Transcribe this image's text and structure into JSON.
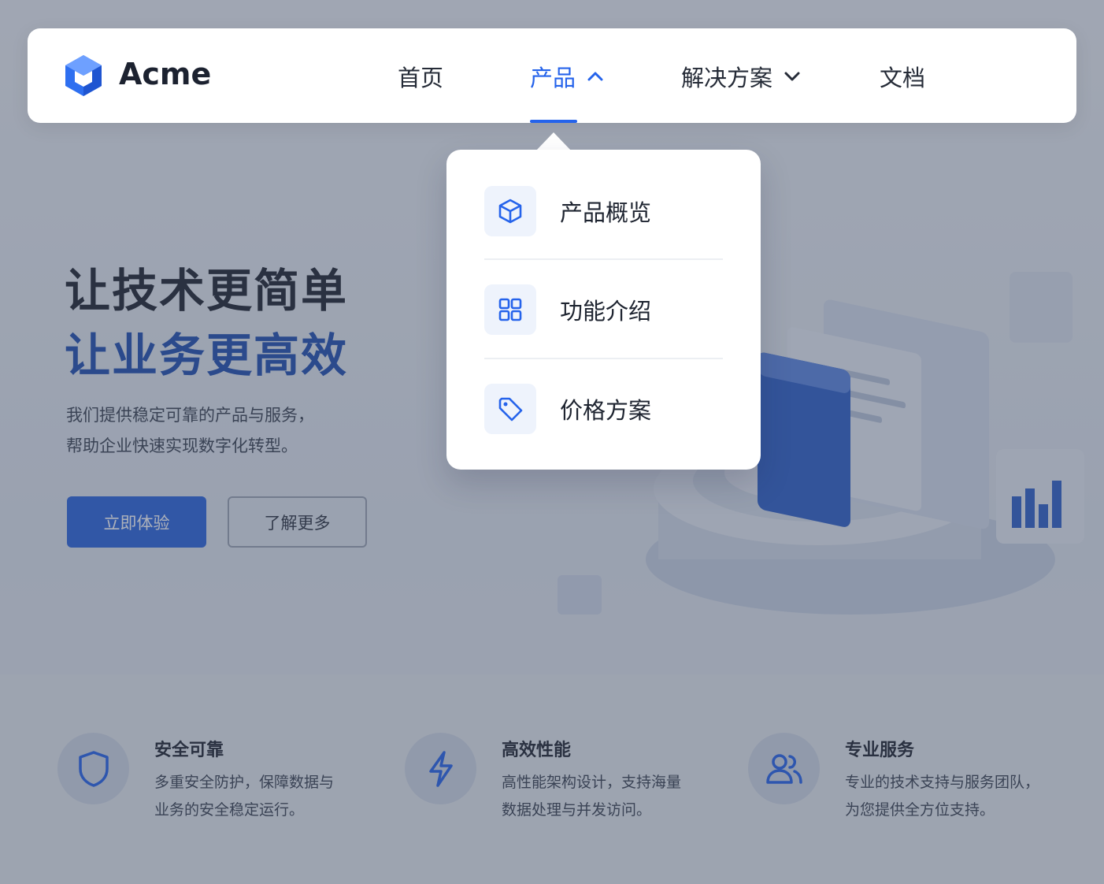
{
  "brand": {
    "name": "Acme"
  },
  "nav": {
    "items": [
      {
        "label": "首页"
      },
      {
        "label": "产品",
        "active": true,
        "icon": "chevron-up-icon"
      },
      {
        "label": "解决方案",
        "icon": "chevron-down-icon"
      },
      {
        "label": "文档"
      }
    ]
  },
  "dropdown": {
    "items": [
      {
        "label": "产品概览",
        "icon": "cube-icon"
      },
      {
        "label": "功能介绍",
        "icon": "grid-icon"
      },
      {
        "label": "价格方案",
        "icon": "tag-icon"
      }
    ]
  },
  "hero": {
    "title_line1": "让技术更简单",
    "title_line2": "让业务更高效",
    "desc_line1": "我们提供稳定可靠的产品与服务，",
    "desc_line2": "帮助企业快速实现数字化转型。",
    "primary_button": "立即体验",
    "secondary_button": "了解更多"
  },
  "features": [
    {
      "title": "安全可靠",
      "desc_line1": "多重安全防护，保障数据与",
      "desc_line2": "业务的安全稳定运行。",
      "icon": "shield-icon"
    },
    {
      "title": "高效性能",
      "desc_line1": "高性能架构设计，支持海量",
      "desc_line2": "数据处理与并发访问。",
      "icon": "lightning-icon"
    },
    {
      "title": "专业服务",
      "desc_line1": "专业的技术支持与服务团队，",
      "desc_line2": "为您提供全方位支持。",
      "icon": "users-icon"
    }
  ],
  "colors": {
    "accent": "#2563eb",
    "hero_highlight": "#1f4fb0",
    "overlay": "rgba(60,70,90,0.42)"
  }
}
